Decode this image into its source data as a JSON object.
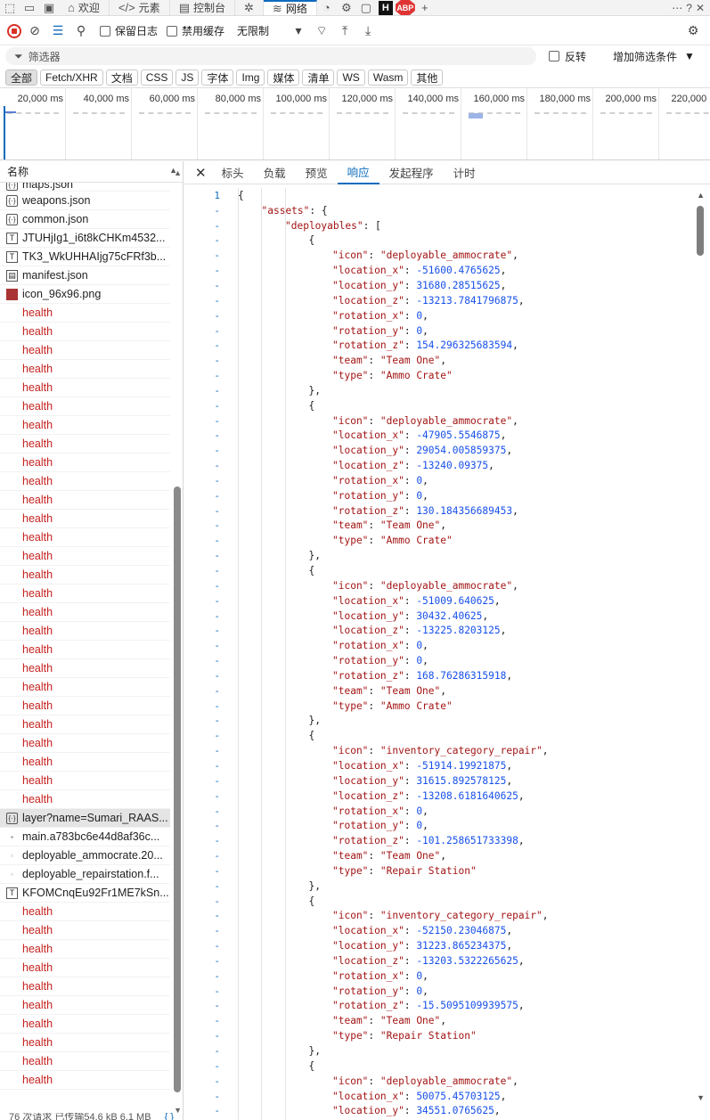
{
  "tabbar": {
    "tabs": [
      {
        "icon": "home-icon",
        "label": "欢迎"
      },
      {
        "icon": "code-icon",
        "label": "元素"
      },
      {
        "icon": "console-icon",
        "label": "控制台"
      },
      {
        "icon": "bug-icon",
        "label": ""
      },
      {
        "icon": "wifi-icon",
        "label": "网络"
      }
    ],
    "extension_badge_h": "H",
    "extension_badge_abp": "ABP"
  },
  "toolbar": {
    "preserve_log": "保留日志",
    "disable_cache": "禁用缓存",
    "throttle": "无限制"
  },
  "filter": {
    "placeholder": "筛选器",
    "invert": "反转",
    "add_filter": "增加筛选条件"
  },
  "chips": [
    "全部",
    "Fetch/XHR",
    "文档",
    "CSS",
    "JS",
    "字体",
    "Img",
    "媒体",
    "清单",
    "WS",
    "Wasm",
    "其他"
  ],
  "timeline": {
    "ticks": [
      "20,000 ms",
      "40,000 ms",
      "60,000 ms",
      "80,000 ms",
      "100,000 ms",
      "120,000 ms",
      "140,000 ms",
      "160,000 ms",
      "180,000 ms",
      "200,000 ms",
      "220,000 ms"
    ]
  },
  "list": {
    "header": "名称",
    "rows": [
      {
        "type": "json",
        "name": "maps.json",
        "clipped": true
      },
      {
        "type": "json",
        "name": "weapons.json"
      },
      {
        "type": "json",
        "name": "common.json"
      },
      {
        "type": "txt",
        "name": "JTUHjIg1_i6t8kCHKm4532..."
      },
      {
        "type": "txt",
        "name": "TK3_WkUHHAIjg75cFRf3b..."
      },
      {
        "type": "doc",
        "name": "manifest.json"
      },
      {
        "type": "png",
        "name": "icon_96x96.png"
      },
      {
        "type": "health",
        "name": "health"
      },
      {
        "type": "health",
        "name": "health"
      },
      {
        "type": "health",
        "name": "health"
      },
      {
        "type": "health",
        "name": "health"
      },
      {
        "type": "health",
        "name": "health"
      },
      {
        "type": "health",
        "name": "health"
      },
      {
        "type": "health",
        "name": "health"
      },
      {
        "type": "health",
        "name": "health"
      },
      {
        "type": "health",
        "name": "health"
      },
      {
        "type": "health",
        "name": "health"
      },
      {
        "type": "health",
        "name": "health"
      },
      {
        "type": "health",
        "name": "health"
      },
      {
        "type": "health",
        "name": "health"
      },
      {
        "type": "health",
        "name": "health"
      },
      {
        "type": "health",
        "name": "health"
      },
      {
        "type": "health",
        "name": "health"
      },
      {
        "type": "health",
        "name": "health"
      },
      {
        "type": "health",
        "name": "health"
      },
      {
        "type": "health",
        "name": "health"
      },
      {
        "type": "health",
        "name": "health"
      },
      {
        "type": "health",
        "name": "health"
      },
      {
        "type": "health",
        "name": "health"
      },
      {
        "type": "health",
        "name": "health"
      },
      {
        "type": "health",
        "name": "health"
      },
      {
        "type": "health",
        "name": "health"
      },
      {
        "type": "health",
        "name": "health"
      },
      {
        "type": "health",
        "name": "health"
      },
      {
        "type": "json",
        "name": "layer?name=Sumari_RAAS...",
        "selected": true
      },
      {
        "type": "js",
        "name": "main.a783bc6e44d8af36c..."
      },
      {
        "type": "img",
        "name": "deployable_ammocrate.20..."
      },
      {
        "type": "img",
        "name": "deployable_repairstation.f..."
      },
      {
        "type": "txt",
        "name": "KFOMCnqEu92Fr1ME7kSn..."
      },
      {
        "type": "health",
        "name": "health"
      },
      {
        "type": "health",
        "name": "health"
      },
      {
        "type": "health",
        "name": "health"
      },
      {
        "type": "health",
        "name": "health"
      },
      {
        "type": "health",
        "name": "health"
      },
      {
        "type": "health",
        "name": "health"
      },
      {
        "type": "health",
        "name": "health"
      },
      {
        "type": "health",
        "name": "health"
      },
      {
        "type": "health",
        "name": "health"
      },
      {
        "type": "health",
        "name": "health"
      }
    ]
  },
  "detail": {
    "tabs": [
      "标头",
      "负载",
      "预览",
      "响应",
      "发起程序",
      "计时"
    ],
    "active_tab": "响应",
    "first_line_number": "1",
    "collapse_marker": "-",
    "lines": [
      [
        {
          "t": "p",
          "v": "{"
        }
      ],
      [
        {
          "t": "k",
          "v": "\"assets\""
        },
        {
          "t": "p",
          "v": ": {"
        }
      ],
      [
        {
          "t": "k",
          "v": "\"deployables\""
        },
        {
          "t": "p",
          "v": ": ["
        }
      ],
      [
        {
          "t": "p",
          "v": "{"
        }
      ],
      [
        {
          "t": "k",
          "v": "\"icon\""
        },
        {
          "t": "p",
          "v": ": "
        },
        {
          "t": "s",
          "v": "\"deployable_ammocrate\""
        },
        {
          "t": "p",
          "v": ","
        }
      ],
      [
        {
          "t": "k",
          "v": "\"location_x\""
        },
        {
          "t": "p",
          "v": ": "
        },
        {
          "t": "n",
          "v": "-51600.4765625"
        },
        {
          "t": "p",
          "v": ","
        }
      ],
      [
        {
          "t": "k",
          "v": "\"location_y\""
        },
        {
          "t": "p",
          "v": ": "
        },
        {
          "t": "n",
          "v": "31680.28515625"
        },
        {
          "t": "p",
          "v": ","
        }
      ],
      [
        {
          "t": "k",
          "v": "\"location_z\""
        },
        {
          "t": "p",
          "v": ": "
        },
        {
          "t": "n",
          "v": "-13213.7841796875"
        },
        {
          "t": "p",
          "v": ","
        }
      ],
      [
        {
          "t": "k",
          "v": "\"rotation_x\""
        },
        {
          "t": "p",
          "v": ": "
        },
        {
          "t": "n",
          "v": "0"
        },
        {
          "t": "p",
          "v": ","
        }
      ],
      [
        {
          "t": "k",
          "v": "\"rotation_y\""
        },
        {
          "t": "p",
          "v": ": "
        },
        {
          "t": "n",
          "v": "0"
        },
        {
          "t": "p",
          "v": ","
        }
      ],
      [
        {
          "t": "k",
          "v": "\"rotation_z\""
        },
        {
          "t": "p",
          "v": ": "
        },
        {
          "t": "n",
          "v": "154.296325683594"
        },
        {
          "t": "p",
          "v": ","
        }
      ],
      [
        {
          "t": "k",
          "v": "\"team\""
        },
        {
          "t": "p",
          "v": ": "
        },
        {
          "t": "s",
          "v": "\"Team One\""
        },
        {
          "t": "p",
          "v": ","
        }
      ],
      [
        {
          "t": "k",
          "v": "\"type\""
        },
        {
          "t": "p",
          "v": ": "
        },
        {
          "t": "s",
          "v": "\"Ammo Crate\""
        }
      ],
      [
        {
          "t": "p",
          "v": "},"
        }
      ],
      [
        {
          "t": "p",
          "v": "{"
        }
      ],
      [
        {
          "t": "k",
          "v": "\"icon\""
        },
        {
          "t": "p",
          "v": ": "
        },
        {
          "t": "s",
          "v": "\"deployable_ammocrate\""
        },
        {
          "t": "p",
          "v": ","
        }
      ],
      [
        {
          "t": "k",
          "v": "\"location_x\""
        },
        {
          "t": "p",
          "v": ": "
        },
        {
          "t": "n",
          "v": "-47905.5546875"
        },
        {
          "t": "p",
          "v": ","
        }
      ],
      [
        {
          "t": "k",
          "v": "\"location_y\""
        },
        {
          "t": "p",
          "v": ": "
        },
        {
          "t": "n",
          "v": "29054.005859375"
        },
        {
          "t": "p",
          "v": ","
        }
      ],
      [
        {
          "t": "k",
          "v": "\"location_z\""
        },
        {
          "t": "p",
          "v": ": "
        },
        {
          "t": "n",
          "v": "-13240.09375"
        },
        {
          "t": "p",
          "v": ","
        }
      ],
      [
        {
          "t": "k",
          "v": "\"rotation_x\""
        },
        {
          "t": "p",
          "v": ": "
        },
        {
          "t": "n",
          "v": "0"
        },
        {
          "t": "p",
          "v": ","
        }
      ],
      [
        {
          "t": "k",
          "v": "\"rotation_y\""
        },
        {
          "t": "p",
          "v": ": "
        },
        {
          "t": "n",
          "v": "0"
        },
        {
          "t": "p",
          "v": ","
        }
      ],
      [
        {
          "t": "k",
          "v": "\"rotation_z\""
        },
        {
          "t": "p",
          "v": ": "
        },
        {
          "t": "n",
          "v": "130.184356689453"
        },
        {
          "t": "p",
          "v": ","
        }
      ],
      [
        {
          "t": "k",
          "v": "\"team\""
        },
        {
          "t": "p",
          "v": ": "
        },
        {
          "t": "s",
          "v": "\"Team One\""
        },
        {
          "t": "p",
          "v": ","
        }
      ],
      [
        {
          "t": "k",
          "v": "\"type\""
        },
        {
          "t": "p",
          "v": ": "
        },
        {
          "t": "s",
          "v": "\"Ammo Crate\""
        }
      ],
      [
        {
          "t": "p",
          "v": "},"
        }
      ],
      [
        {
          "t": "p",
          "v": "{"
        }
      ],
      [
        {
          "t": "k",
          "v": "\"icon\""
        },
        {
          "t": "p",
          "v": ": "
        },
        {
          "t": "s",
          "v": "\"deployable_ammocrate\""
        },
        {
          "t": "p",
          "v": ","
        }
      ],
      [
        {
          "t": "k",
          "v": "\"location_x\""
        },
        {
          "t": "p",
          "v": ": "
        },
        {
          "t": "n",
          "v": "-51009.640625"
        },
        {
          "t": "p",
          "v": ","
        }
      ],
      [
        {
          "t": "k",
          "v": "\"location_y\""
        },
        {
          "t": "p",
          "v": ": "
        },
        {
          "t": "n",
          "v": "30432.40625"
        },
        {
          "t": "p",
          "v": ","
        }
      ],
      [
        {
          "t": "k",
          "v": "\"location_z\""
        },
        {
          "t": "p",
          "v": ": "
        },
        {
          "t": "n",
          "v": "-13225.8203125"
        },
        {
          "t": "p",
          "v": ","
        }
      ],
      [
        {
          "t": "k",
          "v": "\"rotation_x\""
        },
        {
          "t": "p",
          "v": ": "
        },
        {
          "t": "n",
          "v": "0"
        },
        {
          "t": "p",
          "v": ","
        }
      ],
      [
        {
          "t": "k",
          "v": "\"rotation_y\""
        },
        {
          "t": "p",
          "v": ": "
        },
        {
          "t": "n",
          "v": "0"
        },
        {
          "t": "p",
          "v": ","
        }
      ],
      [
        {
          "t": "k",
          "v": "\"rotation_z\""
        },
        {
          "t": "p",
          "v": ": "
        },
        {
          "t": "n",
          "v": "168.76286315918"
        },
        {
          "t": "p",
          "v": ","
        }
      ],
      [
        {
          "t": "k",
          "v": "\"team\""
        },
        {
          "t": "p",
          "v": ": "
        },
        {
          "t": "s",
          "v": "\"Team One\""
        },
        {
          "t": "p",
          "v": ","
        }
      ],
      [
        {
          "t": "k",
          "v": "\"type\""
        },
        {
          "t": "p",
          "v": ": "
        },
        {
          "t": "s",
          "v": "\"Ammo Crate\""
        }
      ],
      [
        {
          "t": "p",
          "v": "},"
        }
      ],
      [
        {
          "t": "p",
          "v": "{"
        }
      ],
      [
        {
          "t": "k",
          "v": "\"icon\""
        },
        {
          "t": "p",
          "v": ": "
        },
        {
          "t": "s",
          "v": "\"inventory_category_repair\""
        },
        {
          "t": "p",
          "v": ","
        }
      ],
      [
        {
          "t": "k",
          "v": "\"location_x\""
        },
        {
          "t": "p",
          "v": ": "
        },
        {
          "t": "n",
          "v": "-51914.19921875"
        },
        {
          "t": "p",
          "v": ","
        }
      ],
      [
        {
          "t": "k",
          "v": "\"location_y\""
        },
        {
          "t": "p",
          "v": ": "
        },
        {
          "t": "n",
          "v": "31615.892578125"
        },
        {
          "t": "p",
          "v": ","
        }
      ],
      [
        {
          "t": "k",
          "v": "\"location_z\""
        },
        {
          "t": "p",
          "v": ": "
        },
        {
          "t": "n",
          "v": "-13208.6181640625"
        },
        {
          "t": "p",
          "v": ","
        }
      ],
      [
        {
          "t": "k",
          "v": "\"rotation_x\""
        },
        {
          "t": "p",
          "v": ": "
        },
        {
          "t": "n",
          "v": "0"
        },
        {
          "t": "p",
          "v": ","
        }
      ],
      [
        {
          "t": "k",
          "v": "\"rotation_y\""
        },
        {
          "t": "p",
          "v": ": "
        },
        {
          "t": "n",
          "v": "0"
        },
        {
          "t": "p",
          "v": ","
        }
      ],
      [
        {
          "t": "k",
          "v": "\"rotation_z\""
        },
        {
          "t": "p",
          "v": ": "
        },
        {
          "t": "n",
          "v": "-101.258651733398"
        },
        {
          "t": "p",
          "v": ","
        }
      ],
      [
        {
          "t": "k",
          "v": "\"team\""
        },
        {
          "t": "p",
          "v": ": "
        },
        {
          "t": "s",
          "v": "\"Team One\""
        },
        {
          "t": "p",
          "v": ","
        }
      ],
      [
        {
          "t": "k",
          "v": "\"type\""
        },
        {
          "t": "p",
          "v": ": "
        },
        {
          "t": "s",
          "v": "\"Repair Station\""
        }
      ],
      [
        {
          "t": "p",
          "v": "},"
        }
      ],
      [
        {
          "t": "p",
          "v": "{"
        }
      ],
      [
        {
          "t": "k",
          "v": "\"icon\""
        },
        {
          "t": "p",
          "v": ": "
        },
        {
          "t": "s",
          "v": "\"inventory_category_repair\""
        },
        {
          "t": "p",
          "v": ","
        }
      ],
      [
        {
          "t": "k",
          "v": "\"location_x\""
        },
        {
          "t": "p",
          "v": ": "
        },
        {
          "t": "n",
          "v": "-52150.23046875"
        },
        {
          "t": "p",
          "v": ","
        }
      ],
      [
        {
          "t": "k",
          "v": "\"location_y\""
        },
        {
          "t": "p",
          "v": ": "
        },
        {
          "t": "n",
          "v": "31223.865234375"
        },
        {
          "t": "p",
          "v": ","
        }
      ],
      [
        {
          "t": "k",
          "v": "\"location_z\""
        },
        {
          "t": "p",
          "v": ": "
        },
        {
          "t": "n",
          "v": "-13203.5322265625"
        },
        {
          "t": "p",
          "v": ","
        }
      ],
      [
        {
          "t": "k",
          "v": "\"rotation_x\""
        },
        {
          "t": "p",
          "v": ": "
        },
        {
          "t": "n",
          "v": "0"
        },
        {
          "t": "p",
          "v": ","
        }
      ],
      [
        {
          "t": "k",
          "v": "\"rotation_y\""
        },
        {
          "t": "p",
          "v": ": "
        },
        {
          "t": "n",
          "v": "0"
        },
        {
          "t": "p",
          "v": ","
        }
      ],
      [
        {
          "t": "k",
          "v": "\"rotation_z\""
        },
        {
          "t": "p",
          "v": ": "
        },
        {
          "t": "n",
          "v": "-15.5095109939575"
        },
        {
          "t": "p",
          "v": ","
        }
      ],
      [
        {
          "t": "k",
          "v": "\"team\""
        },
        {
          "t": "p",
          "v": ": "
        },
        {
          "t": "s",
          "v": "\"Team One\""
        },
        {
          "t": "p",
          "v": ","
        }
      ],
      [
        {
          "t": "k",
          "v": "\"type\""
        },
        {
          "t": "p",
          "v": ": "
        },
        {
          "t": "s",
          "v": "\"Repair Station\""
        }
      ],
      [
        {
          "t": "p",
          "v": "},"
        }
      ],
      [
        {
          "t": "p",
          "v": "{"
        }
      ],
      [
        {
          "t": "k",
          "v": "\"icon\""
        },
        {
          "t": "p",
          "v": ": "
        },
        {
          "t": "s",
          "v": "\"deployable_ammocrate\""
        },
        {
          "t": "p",
          "v": ","
        }
      ],
      [
        {
          "t": "k",
          "v": "\"location_x\""
        },
        {
          "t": "p",
          "v": ": "
        },
        {
          "t": "n",
          "v": "50075.45703125"
        },
        {
          "t": "p",
          "v": ","
        }
      ],
      [
        {
          "t": "k",
          "v": "\"location_y\""
        },
        {
          "t": "p",
          "v": ": "
        },
        {
          "t": "n",
          "v": "34551.0765625"
        },
        {
          "t": "p",
          "v": ","
        }
      ]
    ]
  },
  "statusbar": {
    "text": "76 次请求 已传输54.6 kB 6.1 MB",
    "brace": "{ }"
  },
  "colors": {
    "accent": "#0f6cbd",
    "health_red": "#c5221f",
    "json_key": "#a31515",
    "json_number": "#1750eb"
  }
}
